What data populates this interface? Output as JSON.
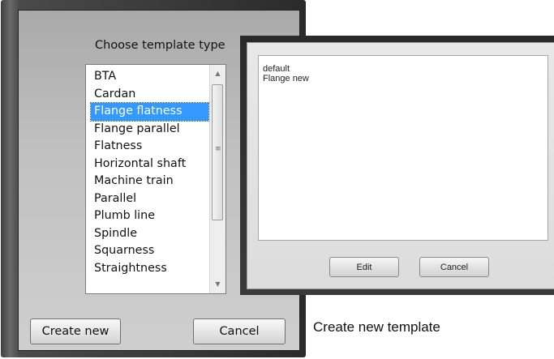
{
  "template_type_dialog": {
    "heading": "Choose template type",
    "items": [
      "BTA",
      "Cardan",
      "Flange flatness",
      "Flange parallel",
      "Flatness",
      "Horizontal shaft",
      "Machine train",
      "Parallel",
      "Plumb line",
      "Spindle",
      "Squarness",
      "Straightness"
    ],
    "selected_item": "Flange flatness",
    "scroll_up_glyph": "▲",
    "scroll_down_glyph": "▼",
    "create_button": "Create new",
    "cancel_button": "Cancel"
  },
  "template_list_dialog": {
    "items": [
      "default",
      "Flange new"
    ],
    "edit_button": "Edit",
    "cancel_button": "Cancel"
  },
  "caption": "Create new template"
}
